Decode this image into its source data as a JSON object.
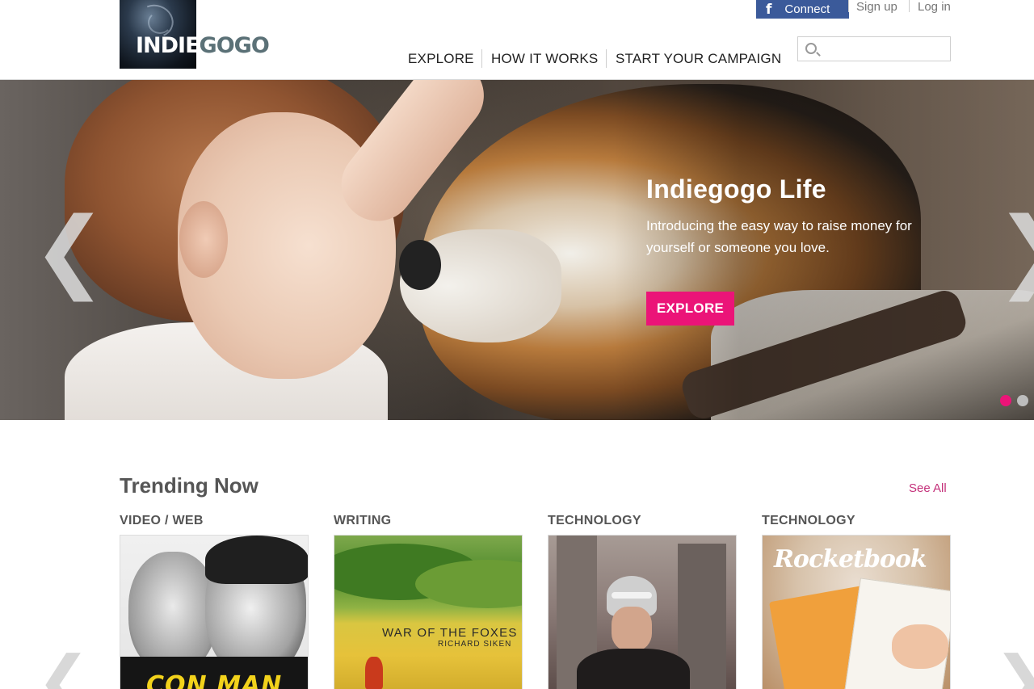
{
  "header": {
    "logo_text_white": "INDIE",
    "logo_text_dark": "GOGO",
    "facebook": {
      "icon": "facebook-f-icon",
      "label": "Connect"
    },
    "signup_label": "Sign up",
    "login_label": "Log in",
    "nav": [
      "EXPLORE",
      "HOW IT WORKS",
      "START YOUR CAMPAIGN"
    ],
    "search": {
      "placeholder": "",
      "value": "",
      "icon": "search-icon"
    }
  },
  "hero": {
    "title": "Indiegogo Life",
    "subtitle": "Introducing the easy way to raise money for yourself or someone you love.",
    "button_label": "EXPLORE",
    "prev_arrow": "❮",
    "next_arrow": "❯",
    "slides_total": 2,
    "active_slide": 1,
    "accent_color": "#eb1478"
  },
  "trending": {
    "title": "Trending Now",
    "see_all_label": "See All",
    "cards": [
      {
        "category": "VIDEO / WEB",
        "image_text": "CON MAN"
      },
      {
        "category": "WRITING",
        "image_title": "WAR OF THE FOXES",
        "image_author": "RICHARD SIKEN"
      },
      {
        "category": "TECHNOLOGY"
      },
      {
        "category": "TECHNOLOGY",
        "image_text": "Rocketbook"
      }
    ],
    "prev_arrow": "❮",
    "next_arrow": "❯"
  },
  "colors": {
    "brand_pink": "#eb1478",
    "facebook_blue": "#3b5a9a",
    "logo_gray": "#5b7177"
  }
}
